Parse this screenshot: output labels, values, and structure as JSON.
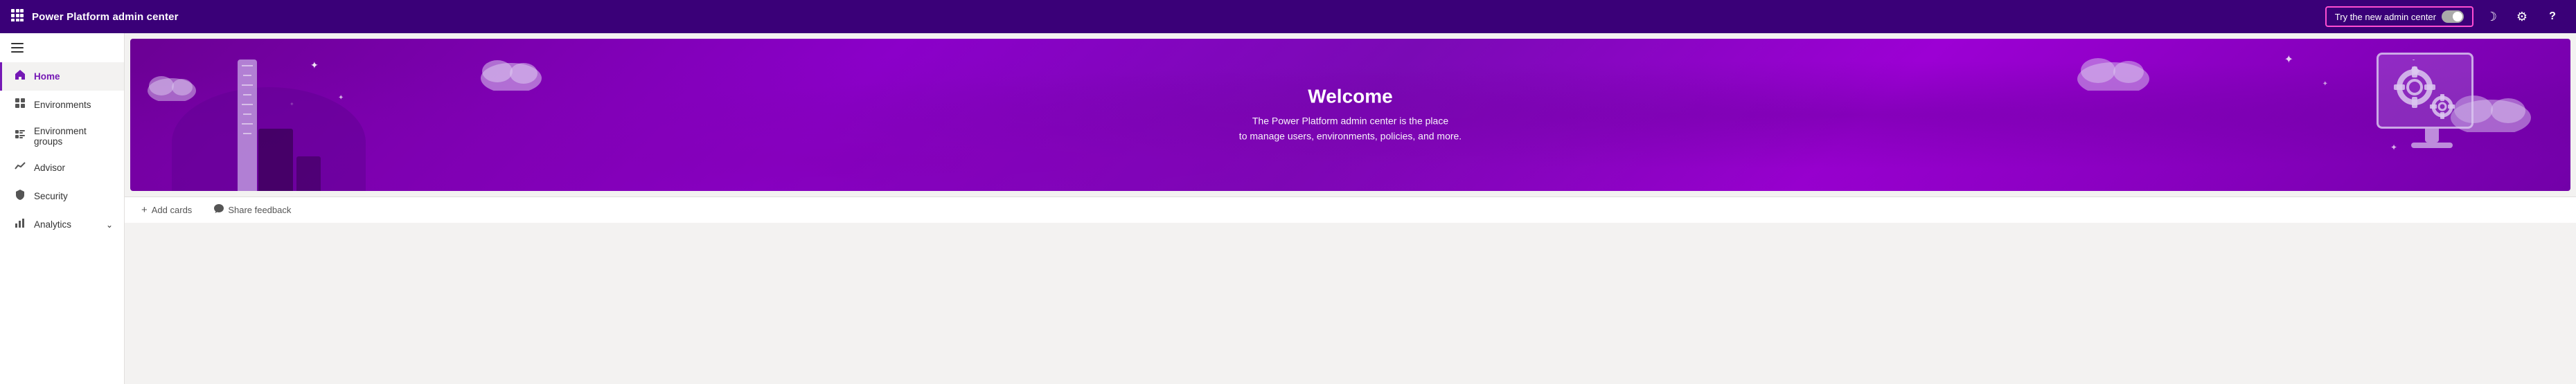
{
  "app": {
    "title": "Power Platform admin center"
  },
  "topbar": {
    "waffle_label": "⊞",
    "try_new_label": "Try the new admin center",
    "moon_icon": "☽",
    "settings_icon": "⚙",
    "help_icon": "?"
  },
  "sidebar": {
    "hamburger": "☰",
    "items": [
      {
        "id": "home",
        "label": "Home",
        "icon": "🏠",
        "active": true
      },
      {
        "id": "environments",
        "label": "Environments",
        "icon": "🌐",
        "active": false
      },
      {
        "id": "environment-groups",
        "label": "Environment groups",
        "icon": "🗂",
        "active": false
      },
      {
        "id": "advisor",
        "label": "Advisor",
        "icon": "📊",
        "active": false
      },
      {
        "id": "security",
        "label": "Security",
        "icon": "🛡",
        "active": false
      },
      {
        "id": "analytics",
        "label": "Analytics",
        "icon": "📈",
        "active": false,
        "hasChevron": true
      }
    ]
  },
  "banner": {
    "welcome_title": "Welcome",
    "welcome_subtitle_line1": "The Power Platform admin center is the place",
    "welcome_subtitle_line2": "to manage users, environments, policies, and more."
  },
  "toolbar": {
    "add_cards_label": "Add cards",
    "share_feedback_label": "Share feedback"
  }
}
